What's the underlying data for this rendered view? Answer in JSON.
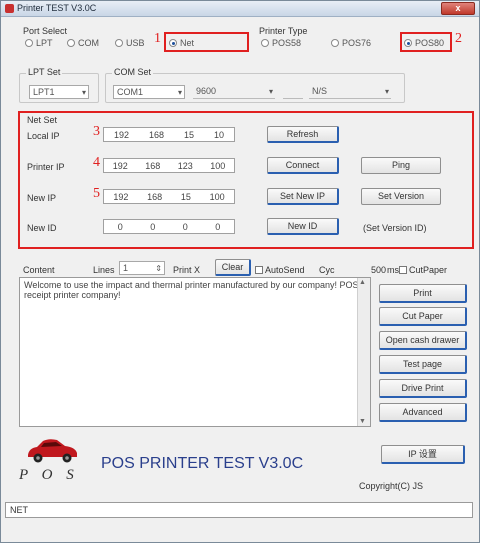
{
  "window": {
    "title": "Printer TEST V3.0C",
    "close_label": "x"
  },
  "port_select": {
    "label": "Port Select",
    "options": [
      "LPT",
      "COM",
      "USB",
      "Net"
    ],
    "selected": "Net",
    "marker": "1"
  },
  "printer_type": {
    "label": "Printer Type",
    "options": [
      "POS58",
      "POS76",
      "POS80"
    ],
    "selected": "POS80",
    "marker": "2"
  },
  "lpt_set": {
    "label": "LPT Set",
    "value": "LPT1"
  },
  "com_set": {
    "label": "COM Set",
    "port": "COM1",
    "baud": "9600",
    "bits": "",
    "parity": "N/S"
  },
  "net_set": {
    "label": "Net Set",
    "local_ip": {
      "label": "Local IP",
      "marker": "3",
      "octets": [
        "192",
        "168",
        "15",
        "10"
      ],
      "button": "Refresh"
    },
    "printer_ip": {
      "label": "Printer IP",
      "marker": "4",
      "octets": [
        "192",
        "168",
        "123",
        "100"
      ],
      "button": "Connect",
      "button2": "Ping"
    },
    "new_ip": {
      "label": "New IP",
      "marker": "5",
      "octets": [
        "192",
        "168",
        "15",
        "100"
      ],
      "button": "Set New IP",
      "button2": "Set Version"
    },
    "new_id": {
      "label": "New ID",
      "octets": [
        "0",
        "0",
        "0",
        "0"
      ],
      "button": "New ID",
      "note": "(Set Version ID)"
    }
  },
  "content": {
    "label": "Content",
    "lines_label": "Lines",
    "lines_value": "1",
    "mark_label": "Print X",
    "clear_button": "Clear",
    "auto_send_label": "AutoSend",
    "cycle_label": "Cyc",
    "cycle_value": "500",
    "ms_label": "ms",
    "cut_paper_label": "CutPaper",
    "text": "Welcome to use the impact and thermal printer manufactured by our company! POS receipt printer company!"
  },
  "side_buttons": [
    "Print",
    "Cut Paper",
    "Open cash drawer",
    "Test page",
    "Drive Print",
    "Advanced"
  ],
  "footer": {
    "logo_text": "P O S",
    "big_title": "POS PRINTER TEST V3.0C",
    "ip_button": "IP 设置",
    "copyright": "Copyright(C) JS",
    "status": "NET"
  }
}
